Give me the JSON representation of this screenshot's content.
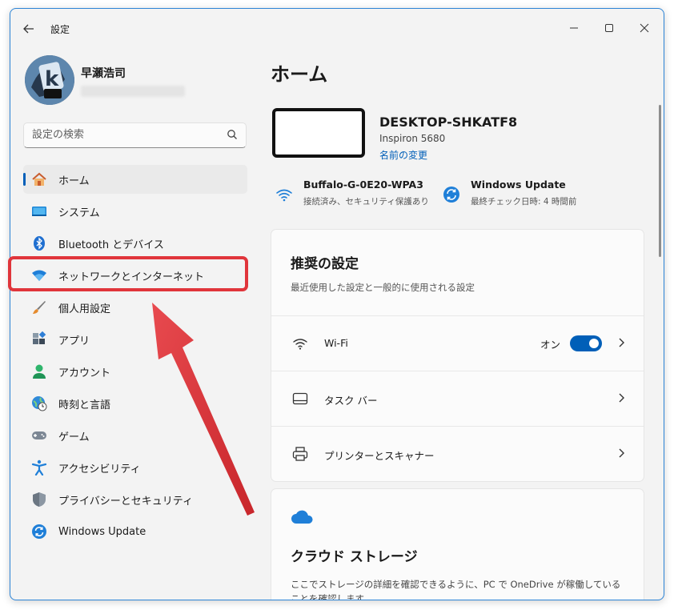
{
  "window": {
    "title": "設定"
  },
  "profile": {
    "name": "早瀬浩司"
  },
  "search": {
    "placeholder": "設定の検索"
  },
  "nav": {
    "items": [
      {
        "label": "ホーム"
      },
      {
        "label": "システム"
      },
      {
        "label": "Bluetooth とデバイス"
      },
      {
        "label": "ネットワークとインターネット"
      },
      {
        "label": "個人用設定"
      },
      {
        "label": "アプリ"
      },
      {
        "label": "アカウント"
      },
      {
        "label": "時刻と言語"
      },
      {
        "label": "ゲーム"
      },
      {
        "label": "アクセシビリティ"
      },
      {
        "label": "プライバシーとセキュリティ"
      },
      {
        "label": "Windows Update"
      }
    ]
  },
  "main": {
    "title": "ホーム",
    "device": {
      "name": "DESKTOP-SHKATF8",
      "model": "Inspiron 5680",
      "rename": "名前の変更"
    },
    "status": {
      "wifi": {
        "title": "Buffalo-G-0E20-WPA3",
        "sub": "接続済み、セキュリティ保護あり"
      },
      "update": {
        "title": "Windows Update",
        "sub": "最終チェック日時: 4 時間前"
      }
    },
    "recommended": {
      "title": "推奨の設定",
      "subtitle": "最近使用した設定と一般的に使用される設定",
      "rows": [
        {
          "label": "Wi-Fi",
          "toggle_label": "オン",
          "toggle_on": true
        },
        {
          "label": "タスク バー"
        },
        {
          "label": "プリンターとスキャナー"
        }
      ]
    },
    "cloud": {
      "title": "クラウド ストレージ",
      "description": "ここでストレージの詳細を確認できるように、PC で OneDrive が稼働していることを確認します。"
    }
  },
  "colors": {
    "accent": "#005fb8",
    "highlight": "#e0353b",
    "window_border": "#2c84d6"
  }
}
